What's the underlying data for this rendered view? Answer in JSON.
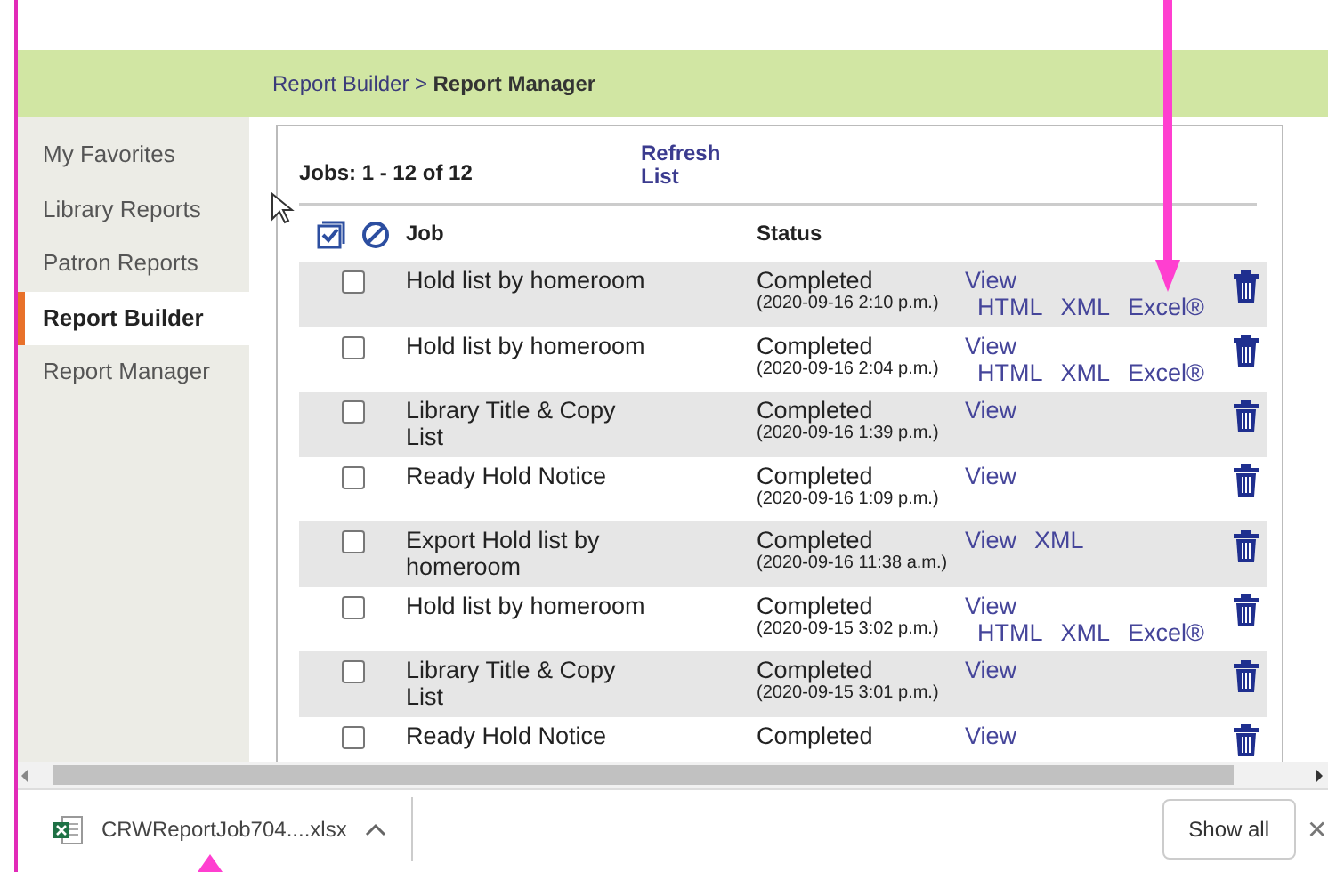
{
  "breadcrumb": {
    "parent": "Report Builder",
    "separator": ">",
    "current": "Report Manager"
  },
  "sidebar": {
    "items": [
      {
        "label": "My Favorites",
        "selected": false
      },
      {
        "label": "Library Reports",
        "selected": false
      },
      {
        "label": "Patron Reports",
        "selected": false
      },
      {
        "label": "Report Builder",
        "selected": true
      },
      {
        "label": "Report Manager",
        "selected": false
      }
    ]
  },
  "jobs_count": "Jobs: 1 - 12 of 12",
  "refresh_link": "Refresh List",
  "table": {
    "columns": [
      "Job",
      "Status"
    ],
    "rows": [
      {
        "checked": false,
        "job": "Hold list by homeroom",
        "status": "Completed",
        "time": "(2020-09-16 2:10 p.m.)",
        "links": [
          [
            "View"
          ],
          [
            "HTML",
            "XML",
            "Excel®"
          ]
        ]
      },
      {
        "checked": false,
        "job": "Hold list by homeroom",
        "status": "Completed",
        "time": "(2020-09-16 2:04 p.m.)",
        "links": [
          [
            "View"
          ],
          [
            "HTML",
            "XML",
            "Excel®"
          ]
        ]
      },
      {
        "checked": false,
        "job": "Library Title & Copy List",
        "status": "Completed",
        "time": "(2020-09-16 1:39 p.m.)",
        "links": [
          [
            "View"
          ]
        ]
      },
      {
        "checked": false,
        "job": "Ready Hold Notice",
        "status": "Completed",
        "time": "(2020-09-16 1:09 p.m.)",
        "links": [
          [
            "View"
          ]
        ]
      },
      {
        "checked": false,
        "job": "Export Hold list by homeroom",
        "status": "Completed",
        "time": "(2020-09-16 11:38 a.m.)",
        "links": [
          [
            "View",
            "XML"
          ]
        ]
      },
      {
        "checked": false,
        "job": "Hold list by homeroom",
        "status": "Completed",
        "time": "(2020-09-15 3:02 p.m.)",
        "links": [
          [
            "View"
          ],
          [
            "HTML",
            "XML",
            "Excel®"
          ]
        ]
      },
      {
        "checked": false,
        "job": "Library Title & Copy List",
        "status": "Completed",
        "time": "(2020-09-15 3:01 p.m.)",
        "links": [
          [
            "View"
          ]
        ]
      },
      {
        "checked": false,
        "job": "Ready Hold Notice",
        "status": "Completed",
        "links": [
          [
            "View"
          ]
        ]
      }
    ]
  },
  "download_bar": {
    "file": "CRWReportJob704....xlsx",
    "show_all": "Show all",
    "close": "✕"
  }
}
